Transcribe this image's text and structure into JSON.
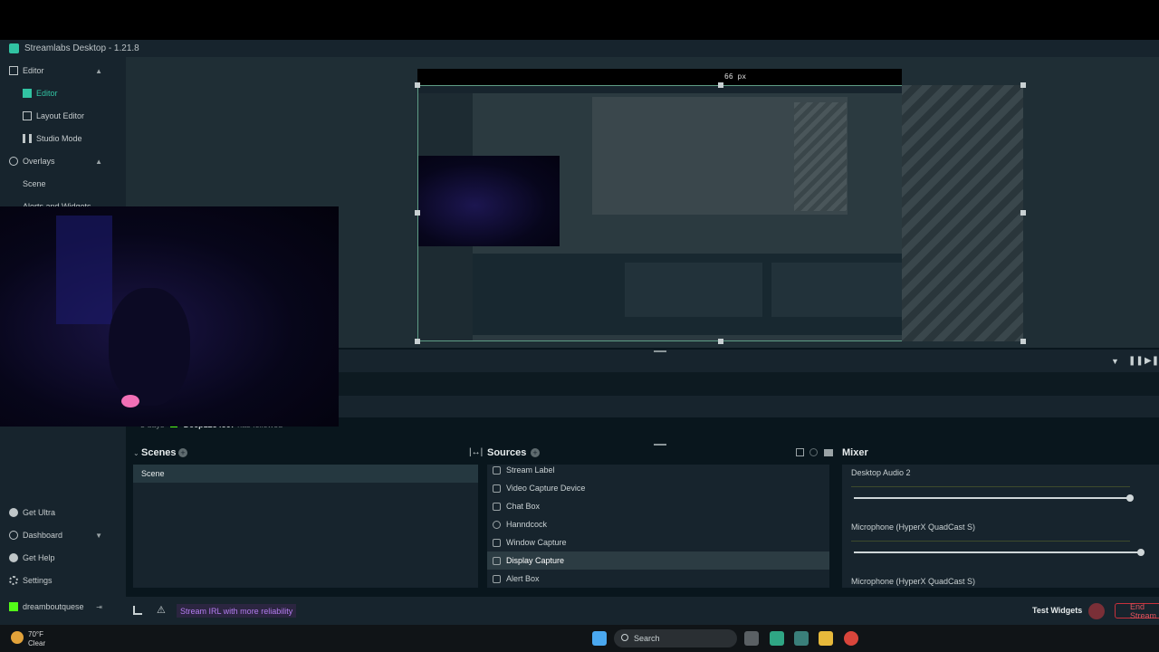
{
  "window": {
    "title": "Streamlabs Desktop - 1.21.8"
  },
  "sidebar": {
    "items": [
      {
        "label": "Editor",
        "level": 0,
        "expanded": true
      },
      {
        "label": "Editor",
        "level": 1,
        "active": true
      },
      {
        "label": "Layout Editor",
        "level": 1
      },
      {
        "label": "Studio Mode",
        "level": 1
      },
      {
        "label": "Overlays",
        "level": 0,
        "expanded": true
      },
      {
        "label": "Scene",
        "level": 1
      },
      {
        "label": "Alerts and Widgets",
        "level": 1
      }
    ],
    "bottom": [
      {
        "label": "Get Ultra"
      },
      {
        "label": "Dashboard"
      },
      {
        "label": "Get Help"
      },
      {
        "label": "Settings"
      },
      {
        "label": "dreamboutquese"
      }
    ]
  },
  "preview": {
    "px_readout": "66 px"
  },
  "feed": {
    "time": "3 days",
    "user": "Deep1234567",
    "action": "has followed"
  },
  "scenes": {
    "title": "Scenes",
    "items": [
      "Scene"
    ],
    "selected": "Scene"
  },
  "sources": {
    "title": "Sources",
    "items": [
      "Stream Label",
      "Video Capture Device",
      "Chat Box",
      "Hanndcock",
      "Window Capture",
      "Display Capture",
      "Alert Box"
    ],
    "selected": "Display Capture"
  },
  "mixer": {
    "title": "Mixer",
    "channels": [
      {
        "name": "Desktop Audio 2",
        "level": 0.96
      },
      {
        "name": "Microphone (HyperX QuadCast S)",
        "level": 1.0
      },
      {
        "name": "Microphone (HyperX QuadCast S)",
        "level": null
      }
    ]
  },
  "footer": {
    "promo": "Stream IRL with more reliability",
    "test_widgets": "Test Widgets",
    "end_stream": "End Stream"
  },
  "taskbar": {
    "weather_temp": "70°F",
    "weather_desc": "Clear",
    "search_placeholder": "Search"
  },
  "colors": {
    "accent": "#31c3a2",
    "panel": "#17242d",
    "bg": "#09161d",
    "danger": "#c8313c",
    "promo": "#b57df2"
  }
}
